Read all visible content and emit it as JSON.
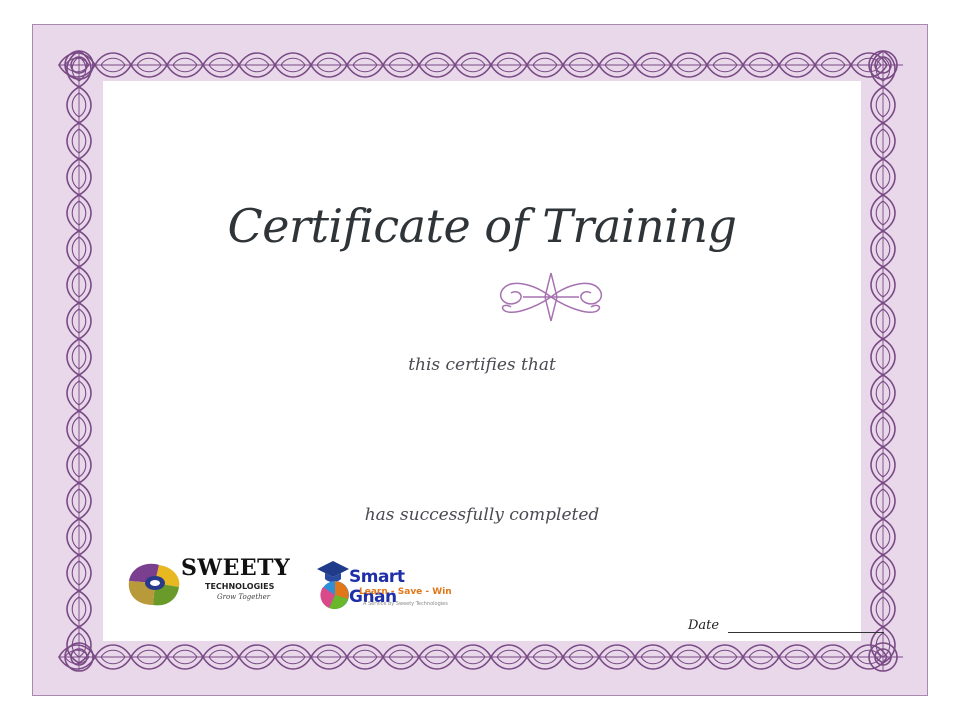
{
  "certificate": {
    "title": "Certificate of Training",
    "certifies_text": "this certifies that",
    "completed_text": "has successfully completed",
    "date_label": "Date"
  },
  "logos": {
    "sweety": {
      "name": "SWEETY",
      "subtitle": "TECHNOLOGIES",
      "tagline": "Grow Together"
    },
    "smartgnan": {
      "name": "Smart Gnan",
      "tagline": "Learn - Save - Win",
      "small": "A Service by Sweety Technologies"
    }
  },
  "colors": {
    "border_fill": "#e8d8ea",
    "ornament": "#7a4a86",
    "title_text": "#2f3438"
  }
}
